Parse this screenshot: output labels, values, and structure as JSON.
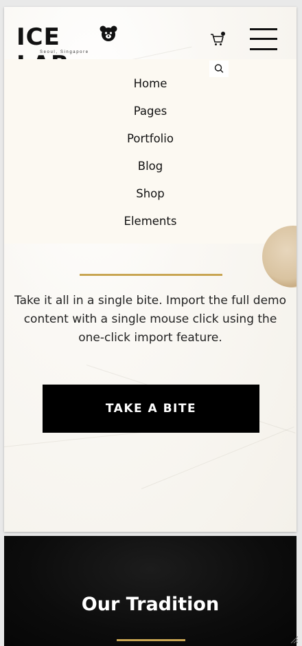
{
  "brand": {
    "logo_text": "ICE LAB",
    "tagline": "Seoul, Singapore"
  },
  "header": {
    "cart_icon": "cart-icon",
    "menu_icon": "hamburger-icon",
    "search_icon": "search-icon"
  },
  "nav": {
    "items": [
      {
        "label": "Home"
      },
      {
        "label": "Pages"
      },
      {
        "label": "Portfolio"
      },
      {
        "label": "Blog"
      },
      {
        "label": "Shop"
      },
      {
        "label": "Elements"
      }
    ]
  },
  "hero": {
    "description": "Take it all in a single bite. Import the full demo content with a single mouse click using the one-click import feature.",
    "cta_label": "TAKE A BITE"
  },
  "tradition": {
    "title": "Our Tradition"
  },
  "colors": {
    "accent_gold": "#c8a552",
    "menu_bg": "#fcf9f2",
    "button_bg": "#000000"
  }
}
